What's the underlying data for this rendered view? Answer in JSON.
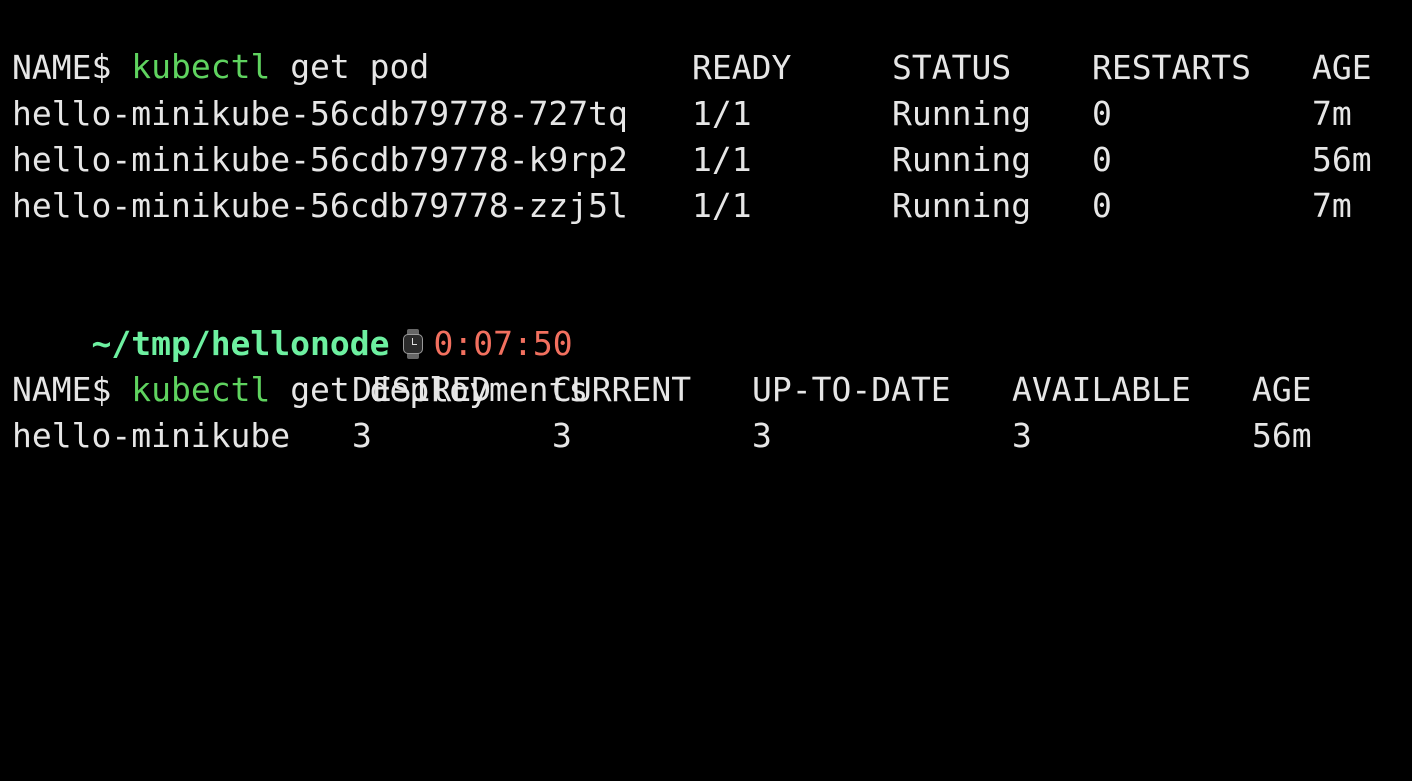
{
  "terminal": {
    "cmd1": {
      "prompt": "$",
      "program": "kubectl",
      "args": "get pod"
    },
    "pods": {
      "headers": [
        "NAME",
        "READY",
        "STATUS",
        "RESTARTS",
        "AGE"
      ],
      "rows": [
        [
          "hello-minikube-56cdb79778-727tq",
          "1/1",
          "Running",
          "0",
          "7m"
        ],
        [
          "hello-minikube-56cdb79778-k9rp2",
          "1/1",
          "Running",
          "0",
          "56m"
        ],
        [
          "hello-minikube-56cdb79778-zzj5l",
          "1/1",
          "Running",
          "0",
          "7m"
        ]
      ]
    },
    "status_line": {
      "path": "~/tmp/hellonode",
      "icon": "watch-icon",
      "time": "0:07:50"
    },
    "cmd2": {
      "prompt": "$",
      "program": "kubectl",
      "args": "get deployments"
    },
    "deployments": {
      "headers": [
        "NAME",
        "DESIRED",
        "CURRENT",
        "UP-TO-DATE",
        "AVAILABLE",
        "AGE"
      ],
      "rows": [
        [
          "hello-minikube",
          "3",
          "3",
          "3",
          "3",
          "56m"
        ]
      ]
    },
    "colors": {
      "background": "#000000",
      "text": "#e6e6e6",
      "command": "#5fd35f",
      "path": "#6df0a0",
      "time": "#f2705f"
    }
  }
}
